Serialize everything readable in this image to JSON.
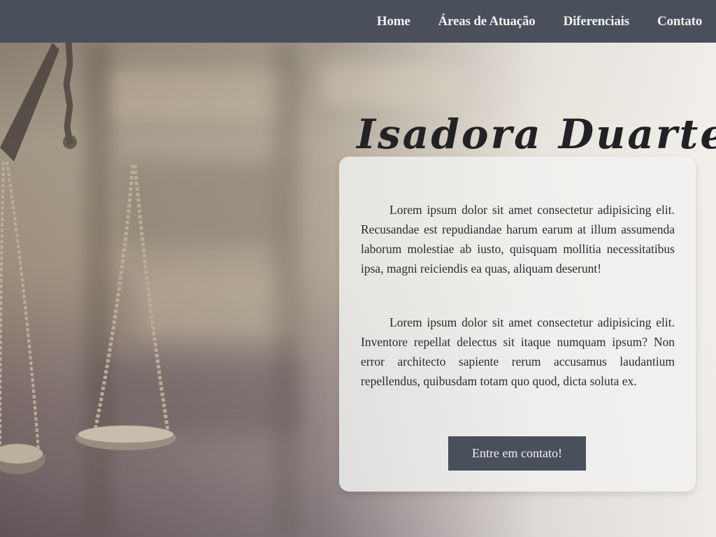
{
  "nav": {
    "items": [
      {
        "label": "Home"
      },
      {
        "label": "Áreas de Atuação"
      },
      {
        "label": "Diferenciais"
      },
      {
        "label": "Contato"
      }
    ]
  },
  "hero": {
    "name": "Isadora  Duarte",
    "paragraphs": [
      "Lorem ipsum dolor sit amet consectetur adipisicing elit. Recusandae est repudiandae harum earum at illum assumenda laborum molestiae ab iusto, quisquam mollitia necessitatibus ipsa, magni reiciendis ea quas, aliquam deserunt!",
      "Lorem ipsum dolor sit amet consectetur adipisicing elit. Inventore repellat delectus sit itaque numquam ipsum? Non error architecto sapiente rerum accusamus laudantium repellendus, quibusdam totam quo quod, dicta soluta ex."
    ],
    "cta_label": "Entre em contato!"
  },
  "images": {
    "background": "scales-of-justice-bookshelf"
  },
  "colors": {
    "nav_bg": "#4a4f5c",
    "nav_text": "#f2f2f2",
    "card_bg": "#f2f1f0",
    "button_bg": "#4a4f5c",
    "text": "#2b2b2e"
  }
}
